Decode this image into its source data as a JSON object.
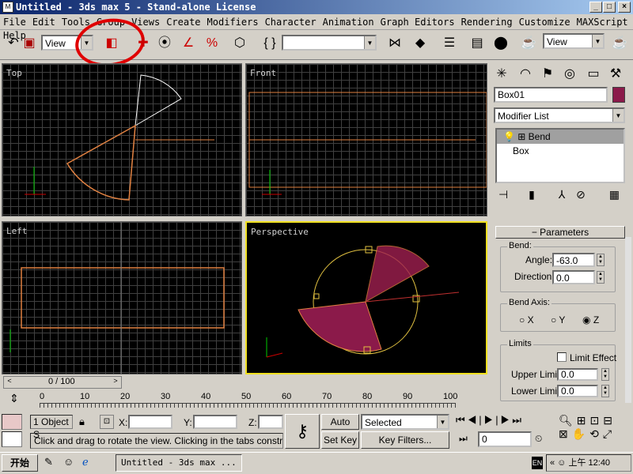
{
  "window": {
    "title": "Untitled - 3ds max 5 - Stand-alone License",
    "icon_text": "M"
  },
  "menu": [
    "File",
    "Edit",
    "Tools",
    "Group",
    "Views",
    "Create",
    "Modifiers",
    "Character",
    "Animation",
    "Graph Editors",
    "Rendering",
    "Customize",
    "MAXScript",
    "Help"
  ],
  "toolbar": {
    "view_dropdown_1": "View",
    "view_dropdown_2": "View",
    "selection_set": ""
  },
  "viewports": {
    "top": "Top",
    "front": "Front",
    "left": "Left",
    "perspective": "Perspective"
  },
  "command_panel": {
    "object_name": "Box01",
    "object_color": "#8b1a4a",
    "modifier_list": "Modifier List",
    "stack": [
      "Bend",
      "Box"
    ],
    "rollout_title": "Parameters",
    "bend_group": "Bend:",
    "angle_label": "Angle:",
    "angle_value": "-63.0",
    "direction_label": "Direction:",
    "direction_value": "0.0",
    "bend_axis_group": "Bend Axis:",
    "axis_x": "X",
    "axis_y": "Y",
    "axis_z": "Z",
    "axis_selected": "Z",
    "limits_group": "Limits",
    "limit_effect": "Limit Effect",
    "upper_limit_label": "Upper Limit:",
    "upper_limit_value": "0.0",
    "lower_limit_label": "Lower Limit:",
    "lower_limit_value": "0.0"
  },
  "timeline": {
    "frame_display": "0 / 100",
    "ticks": [
      "0",
      "10",
      "20",
      "30",
      "40",
      "50",
      "60",
      "70",
      "80",
      "90",
      "100"
    ]
  },
  "status": {
    "selection_info": "1 Object S",
    "x_label": "X:",
    "y_label": "Y:",
    "z_label": "Z:",
    "auto_key": "Auto Key",
    "set_key": "Set Key",
    "key_mode": "Selected",
    "key_filters": "Key Filters...",
    "frame_field": "0",
    "prompt": "Click and drag to rotate the view.  Clicking in the tabs constrains th"
  },
  "taskbar": {
    "start": "开始",
    "task": "Untitled - 3ds max ...",
    "lang": "EN",
    "clock": "上午 12:40"
  },
  "colors": {
    "accent_orange": "#e08040",
    "selection_yellow": "#f0e020",
    "annotation_red": "#e00000"
  }
}
